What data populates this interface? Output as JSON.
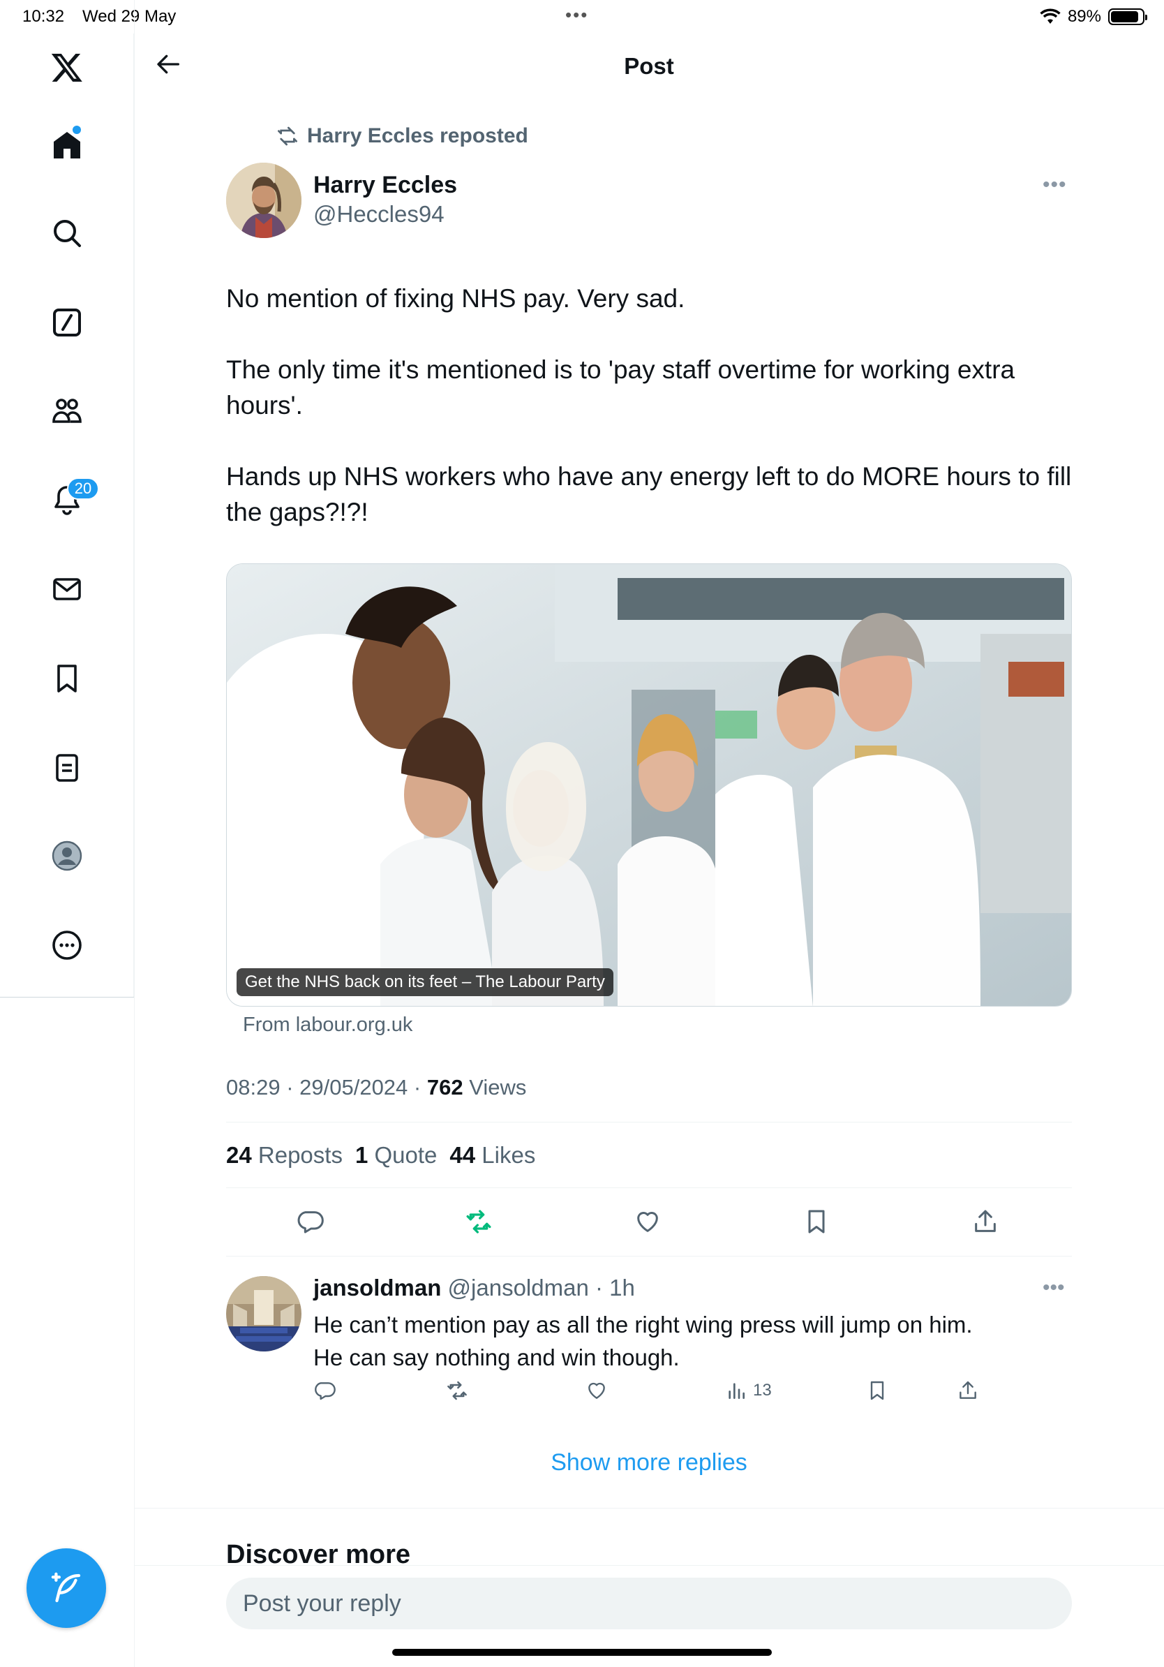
{
  "status_bar": {
    "time": "10:32",
    "date": "Wed 29 May",
    "battery": "89%",
    "battery_level": 0.89
  },
  "sidebar": {
    "items": [
      {
        "name": "x-logo"
      },
      {
        "name": "home"
      },
      {
        "name": "search"
      },
      {
        "name": "grok"
      },
      {
        "name": "communities"
      },
      {
        "name": "notifications",
        "badge": "20"
      },
      {
        "name": "messages"
      },
      {
        "name": "bookmarks"
      },
      {
        "name": "lists"
      },
      {
        "name": "profile"
      },
      {
        "name": "more"
      }
    ]
  },
  "header": {
    "title": "Post"
  },
  "post": {
    "repost_label": "Harry Eccles reposted",
    "author_name": "Harry Eccles",
    "author_handle": "@Heccles94",
    "text": [
      "No mention of fixing NHS pay. Very sad.",
      "The only time it's mentioned is to 'pay staff overtime for working extra hours'.",
      "Hands up NHS workers who have any energy left to do MORE hours to fill the gaps?!?!"
    ],
    "card_caption": "Get the NHS back on its feet – The Labour Party",
    "card_source": "From labour.org.uk",
    "time": "08:29",
    "date": "29/05/2024",
    "views_count": "762",
    "views_label": "Views",
    "reposts_count": "24",
    "reposts_label": "Reposts",
    "quotes_count": "1",
    "quotes_label": "Quote",
    "likes_count": "44",
    "likes_label": "Likes"
  },
  "reply": {
    "author_name": "jansoldman",
    "author_handle": "@jansoldman",
    "time": "1h",
    "text_line1": "He can’t mention pay as all the right wing press will jump on him.",
    "text_line2": "He can say nothing and win though.",
    "views": "13"
  },
  "show_more_replies": "Show more replies",
  "discover_more": "Discover more",
  "reply_box": {
    "placeholder": "Post your reply"
  },
  "colors": {
    "accent": "#1d9bf0",
    "repost_green": "#00ba7c",
    "muted": "#536471"
  }
}
